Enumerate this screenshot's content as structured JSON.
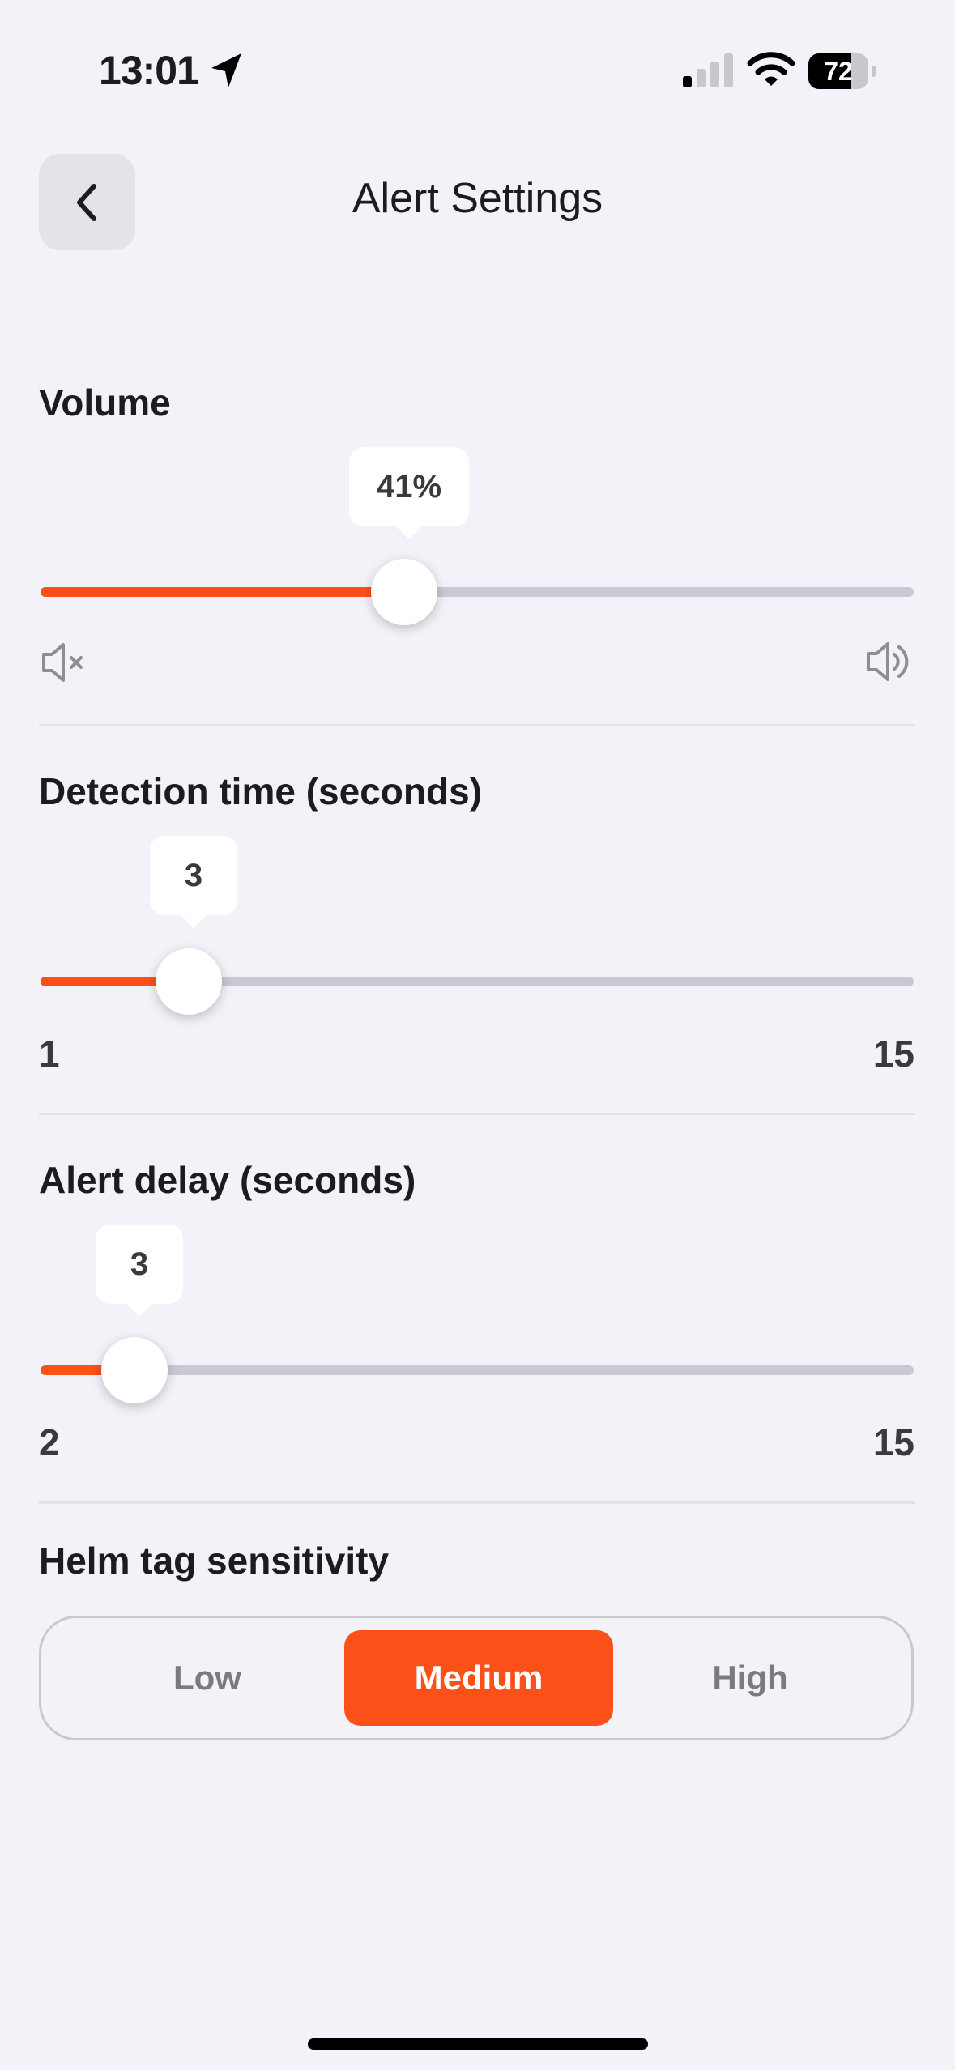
{
  "status_bar": {
    "time": "13:01",
    "battery_level": "72",
    "icons": [
      "location-arrow-icon",
      "signal-icon",
      "wifi-icon",
      "battery-icon"
    ]
  },
  "header": {
    "title": "Alert Settings",
    "back_icon": "chevron-left-icon"
  },
  "volume": {
    "label": "Volume",
    "value_text": "41%",
    "value": 0.41,
    "min_icon": "speaker-mute-icon",
    "max_icon": "speaker-loud-icon"
  },
  "detection_time": {
    "label": "Detection time (seconds)",
    "value": "3",
    "min": "1",
    "max": "15"
  },
  "alert_delay": {
    "label": "Alert delay (seconds)",
    "value": "3",
    "min": "2",
    "max": "15"
  },
  "sensitivity": {
    "label": "Helm tag sensitivity",
    "options": [
      "Low",
      "Medium",
      "High"
    ],
    "selected": "Medium"
  },
  "colors": {
    "accent": "#fb5119",
    "background": "#f2f2f8",
    "track": "#c9c9d1"
  }
}
